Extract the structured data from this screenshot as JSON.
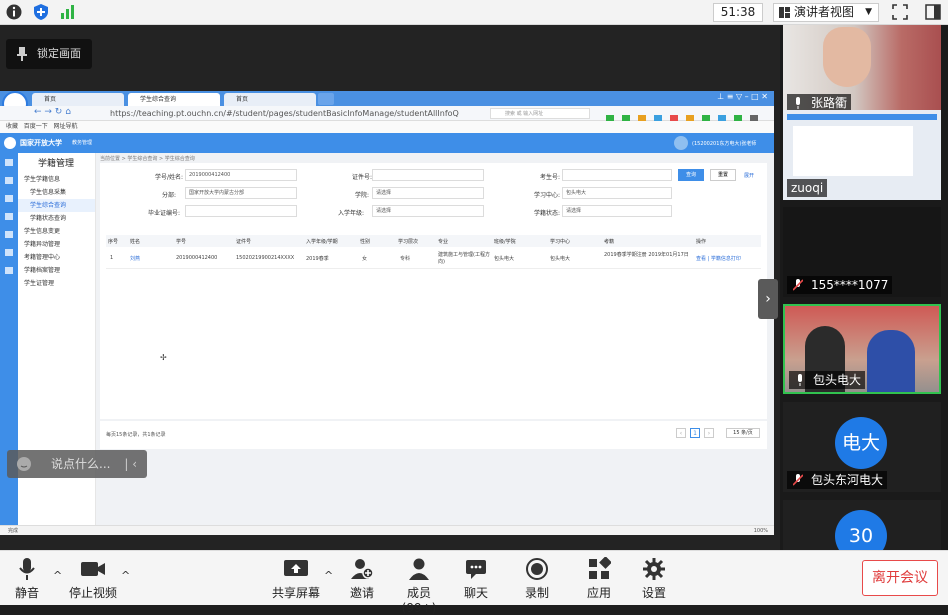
{
  "meeting": {
    "timer": "51:38",
    "view_button": "演讲者视图",
    "lock_label": "锁定画面",
    "chat_placeholder": "说点什么...",
    "leave_label": "离开会议"
  },
  "participants": [
    {
      "name": "张路衢",
      "type": "video",
      "muted": false
    },
    {
      "name": "zuoqi",
      "type": "screen",
      "muted": false
    },
    {
      "name": "155****1077",
      "type": "blank",
      "muted": true
    },
    {
      "name": "包头电大",
      "type": "video",
      "muted": false,
      "active": true
    },
    {
      "name": "包头东河电大",
      "type": "avatar",
      "avatar_text": "电大",
      "muted": true
    },
    {
      "name": "",
      "type": "avatar",
      "avatar_text": "30",
      "muted": false
    }
  ],
  "toolbar": {
    "mute": "静音",
    "stop_video": "停止视频",
    "share": "共享屏幕",
    "invite": "邀请",
    "members": "成员(99+)",
    "chat": "聊天",
    "record": "录制",
    "apps": "应用",
    "settings": "设置"
  },
  "browser": {
    "tabs": [
      "首页",
      "学生综合查询",
      "首页"
    ],
    "url": "https://teaching.pt.ouchn.cn/#/student/pages/studentBasicInfoManage/studentAllInfoQ",
    "search_placeholder": "搜索 或 输入网址",
    "bookmarks": [
      "收藏",
      "百度一下",
      "网址导航"
    ],
    "status_left": "完成",
    "status_right": "100%"
  },
  "site": {
    "name": "国家开放大学",
    "subtitle": "教务管理",
    "user": "(15200201东方电大)张老师",
    "side_title": "学籍管理",
    "menu": [
      "学生学籍信息",
      "学生信息采集",
      "学生综合查询",
      "学籍状态查询",
      "学生信息变更",
      "学籍异动管理",
      "考籍管理中心",
      "学籍档案管理",
      "学生证管理"
    ],
    "breadcrumb": "当前位置 > 学生综合查询 > 学生综合查询",
    "form_labels": [
      "学号/姓名:",
      "证件号:",
      "考生号:",
      "分部:",
      "学院:",
      "学习中心:",
      "毕业证编号:",
      "入学年级:",
      "学籍状态:"
    ],
    "form_values": [
      "2019000412400",
      "",
      "",
      "国家开放大学内蒙古分部",
      "请选择",
      "包头电大",
      "",
      "请选择",
      "请选择"
    ],
    "search_btn": "查询",
    "reset_btn": "重置",
    "expand_btn": "展开",
    "columns": [
      "序号",
      "姓名",
      "学号",
      "证件号",
      "入学年级/学期",
      "性别",
      "学习层次",
      "专业",
      "班级/学院",
      "学习中心",
      "考籍",
      "操作"
    ],
    "rows": [
      [
        "1",
        "刘燕",
        "2019000412400",
        "15020219900214XXXX",
        "2019春季",
        "女",
        "专科",
        "建筑施工与管理(工程方向)",
        "包头电大",
        "包头电大",
        "2019春季学期注册 2019年01月17日",
        "查看 | 学籍信息打印"
      ]
    ],
    "pager_info": "每页15条记录，共1条记录",
    "page_current": "1",
    "page_size": "15 条/页"
  }
}
